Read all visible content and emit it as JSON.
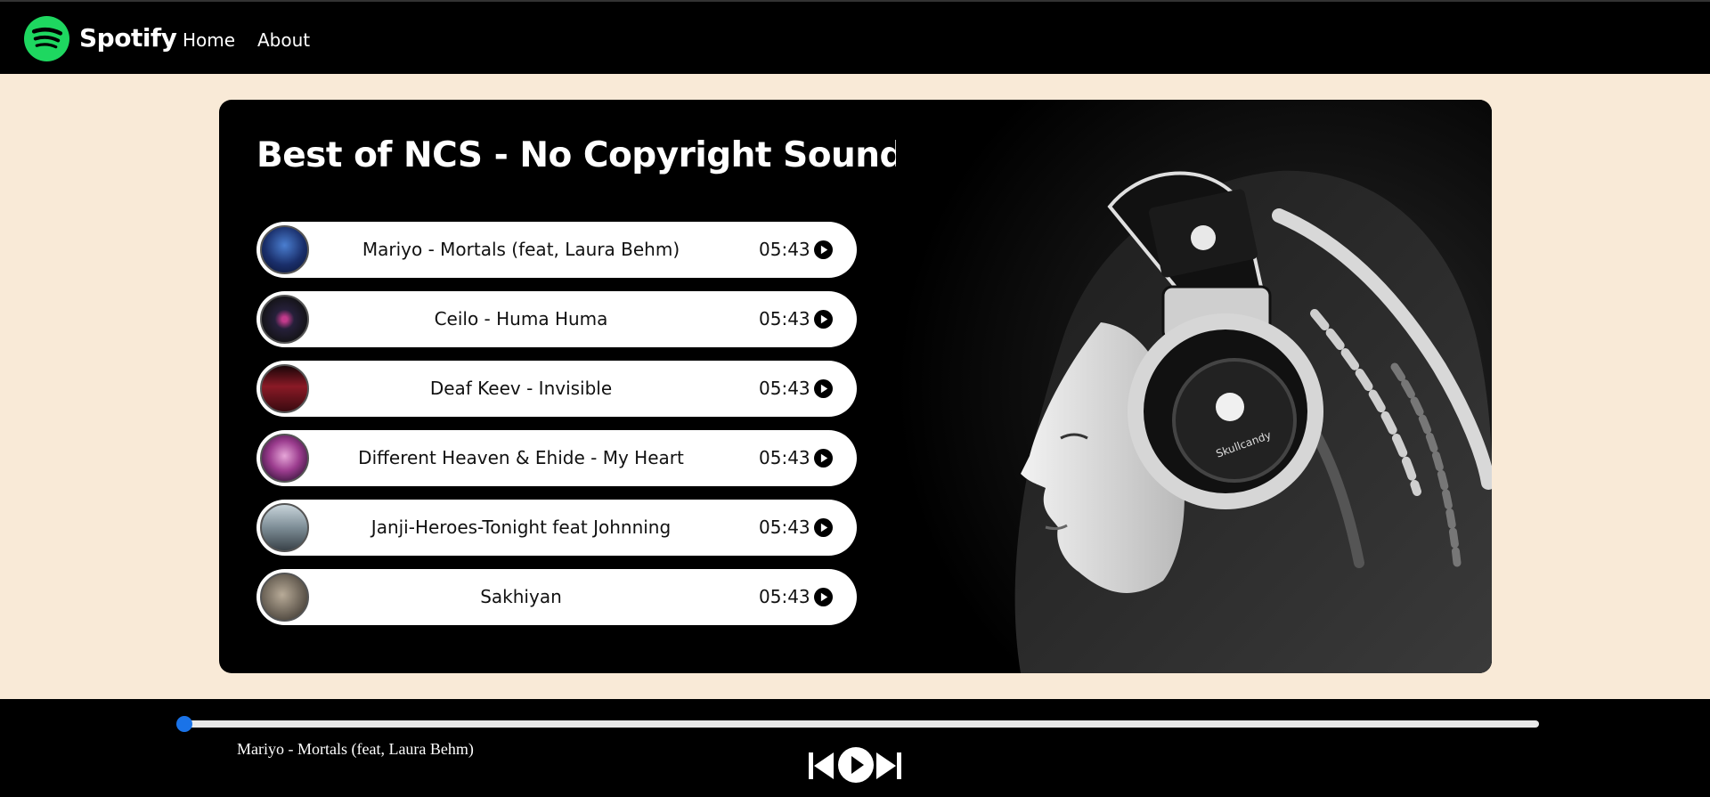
{
  "colors": {
    "accent_green": "#1ed760",
    "background": "#f9ead7",
    "panel": "#000000",
    "progress": "#1a73e8"
  },
  "navbar": {
    "brand": "Spotify",
    "logo_icon": "spotify-logo-icon",
    "links": [
      "Home",
      "About"
    ]
  },
  "playlist": {
    "title": "Best of NCS - No Copyright Sounds",
    "songs": [
      {
        "name": "Mariyo - Mortals (feat, Laura Behm)",
        "duration": "05:43",
        "cover_color": "#1a2f6b"
      },
      {
        "name": "Ceilo - Huma Huma",
        "duration": "05:43",
        "cover_color": "#26203a"
      },
      {
        "name": "Deaf Keev - Invisible",
        "duration": "05:43",
        "cover_color": "#5a1520"
      },
      {
        "name": "Different Heaven & Ehide - My Heart",
        "duration": "05:43",
        "cover_color": "#6b2a63"
      },
      {
        "name": "Janji-Heroes-Tonight feat Johnning",
        "duration": "05:43",
        "cover_color": "#6f7f88"
      },
      {
        "name": "Sakhiyan",
        "duration": "05:43",
        "cover_color": "#6d6458"
      }
    ],
    "play_icon": "play-circle-icon"
  },
  "hero_image": {
    "description_icon": "headphones-girl-image"
  },
  "player": {
    "progress_percent": 0,
    "now_playing": "Mariyo - Mortals (feat, Laura Behm)",
    "controls": [
      "previous-icon",
      "play-icon",
      "next-icon"
    ]
  }
}
